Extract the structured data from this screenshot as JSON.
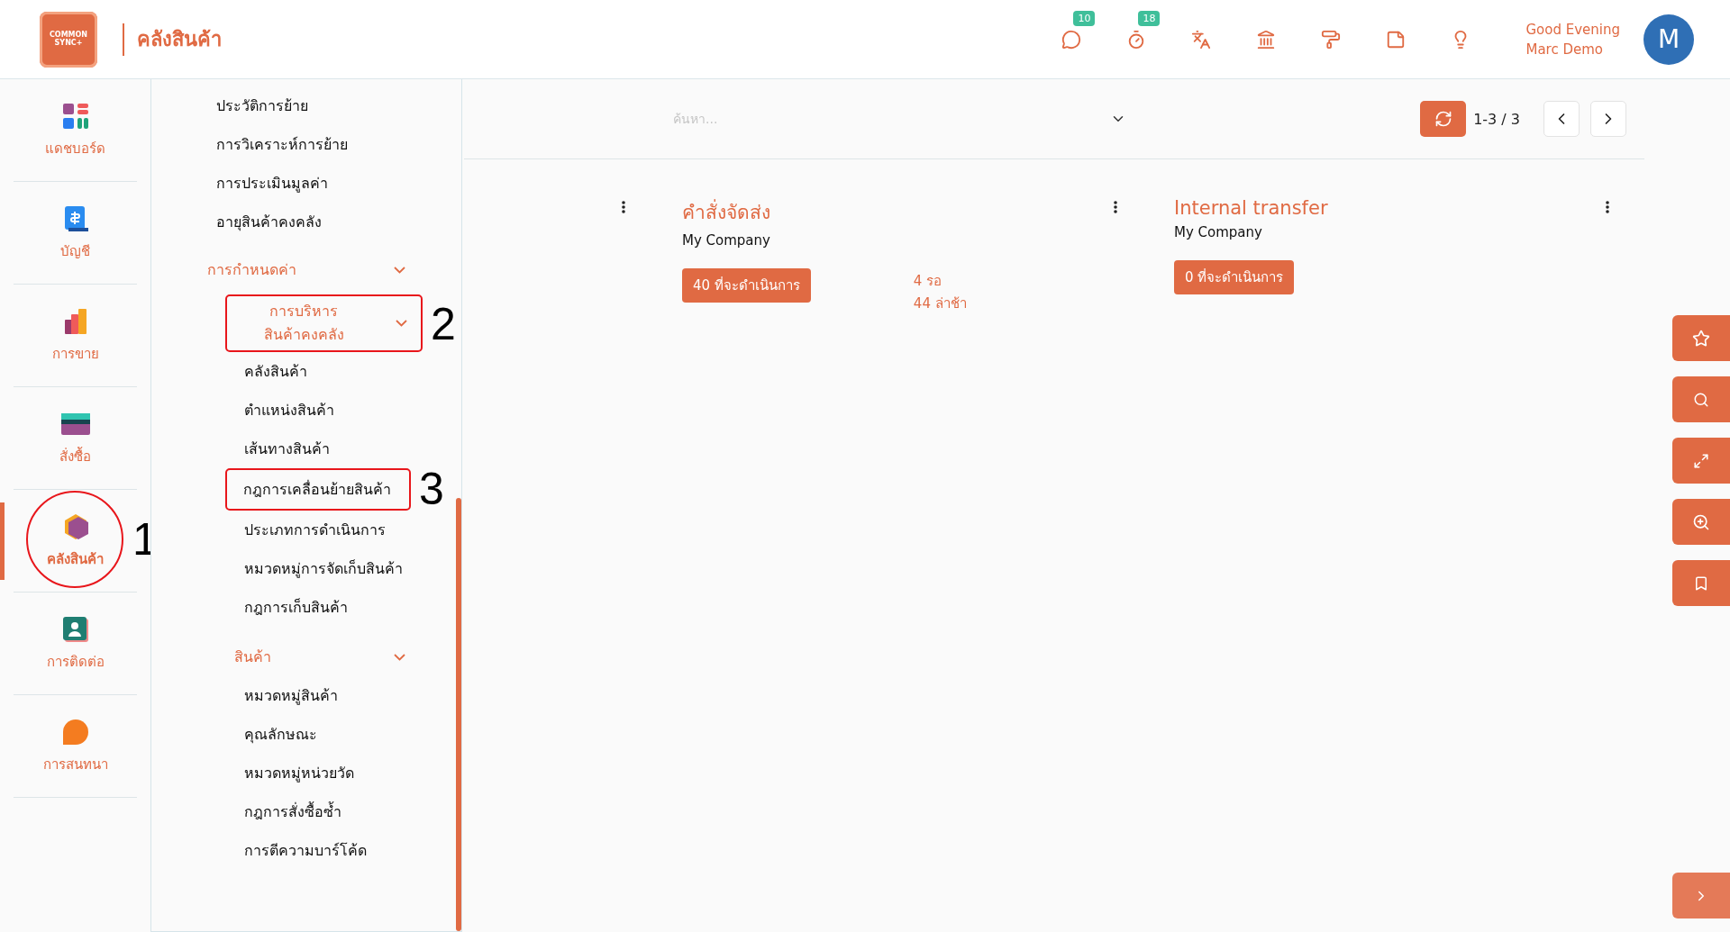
{
  "header": {
    "logo": {
      "lines": [
        "COMMON",
        "SYNC+"
      ]
    },
    "title": "คลังสินค้า",
    "icon_badges": [
      "10",
      "18"
    ],
    "greeting": "Good Evening",
    "user_name": "Marc Demo",
    "avatar": "M"
  },
  "sidebar": {
    "items": [
      {
        "label": "แดชบอร์ด",
        "selected": false
      },
      {
        "label": "บัญชี",
        "selected": false
      },
      {
        "label": "การขาย",
        "selected": false
      },
      {
        "label": "สั่งซื้อ",
        "selected": false
      },
      {
        "label": "คลังสินค้า",
        "selected": true,
        "annotation": "1"
      },
      {
        "label": "การติดต่อ",
        "selected": false
      },
      {
        "label": "การสนทนา",
        "selected": false
      }
    ]
  },
  "menu": {
    "items": [
      {
        "kind": "link",
        "label": "ประวัติการย้าย"
      },
      {
        "kind": "link",
        "label": "การวิเคราะห์การย้าย"
      },
      {
        "kind": "link",
        "label": "การประเมินมูลค่า"
      },
      {
        "kind": "link",
        "label": "อายุสินค้าคงคลัง"
      },
      {
        "kind": "group",
        "label": "การกำหนดค่า",
        "expanded": true,
        "children": [
          {
            "kind": "group",
            "label": "การบริหารสินค้าคงคลัง",
            "expanded": true,
            "annotation": "2",
            "children": [
              {
                "kind": "link",
                "label": "คลังสินค้า"
              },
              {
                "kind": "link",
                "label": "ตำแหน่งสินค้า"
              },
              {
                "kind": "link",
                "label": "เส้นทางสินค้า"
              },
              {
                "kind": "link",
                "label": "กฎการเคลื่อนย้ายสินค้า",
                "annotation": "3"
              },
              {
                "kind": "link",
                "label": "ประเภทการดำเนินการ"
              },
              {
                "kind": "link",
                "label": "หมวดหมู่การจัดเก็บสินค้า"
              },
              {
                "kind": "link",
                "label": "กฎการเก็บสินค้า"
              }
            ]
          },
          {
            "kind": "group",
            "label": "สินค้า",
            "expanded": true,
            "children": [
              {
                "kind": "link",
                "label": "หมวดหมู่สินค้า"
              },
              {
                "kind": "link",
                "label": "คุณลักษณะ"
              },
              {
                "kind": "link",
                "label": "หมวดหมู่หน่วยวัด"
              },
              {
                "kind": "link",
                "label": "กฎการสั่งซื้อซ้ำ"
              },
              {
                "kind": "link",
                "label": "การตีความบาร์โค้ด"
              }
            ]
          }
        ]
      }
    ]
  },
  "toolbar": {
    "search": {
      "placeholder": "ค้นหา..."
    },
    "pager": "1-3 / 3"
  },
  "cards": [
    {
      "title": "คำสั่งจัดส่ง",
      "company": "My Company",
      "button": "40 ที่จะดำเนินการ",
      "counts": [
        "4 รอ",
        "44 ล่าช้า"
      ]
    },
    {
      "title": "Internal transfer",
      "company": "My Company",
      "button": "0 ที่จะดำเนินการ"
    }
  ]
}
